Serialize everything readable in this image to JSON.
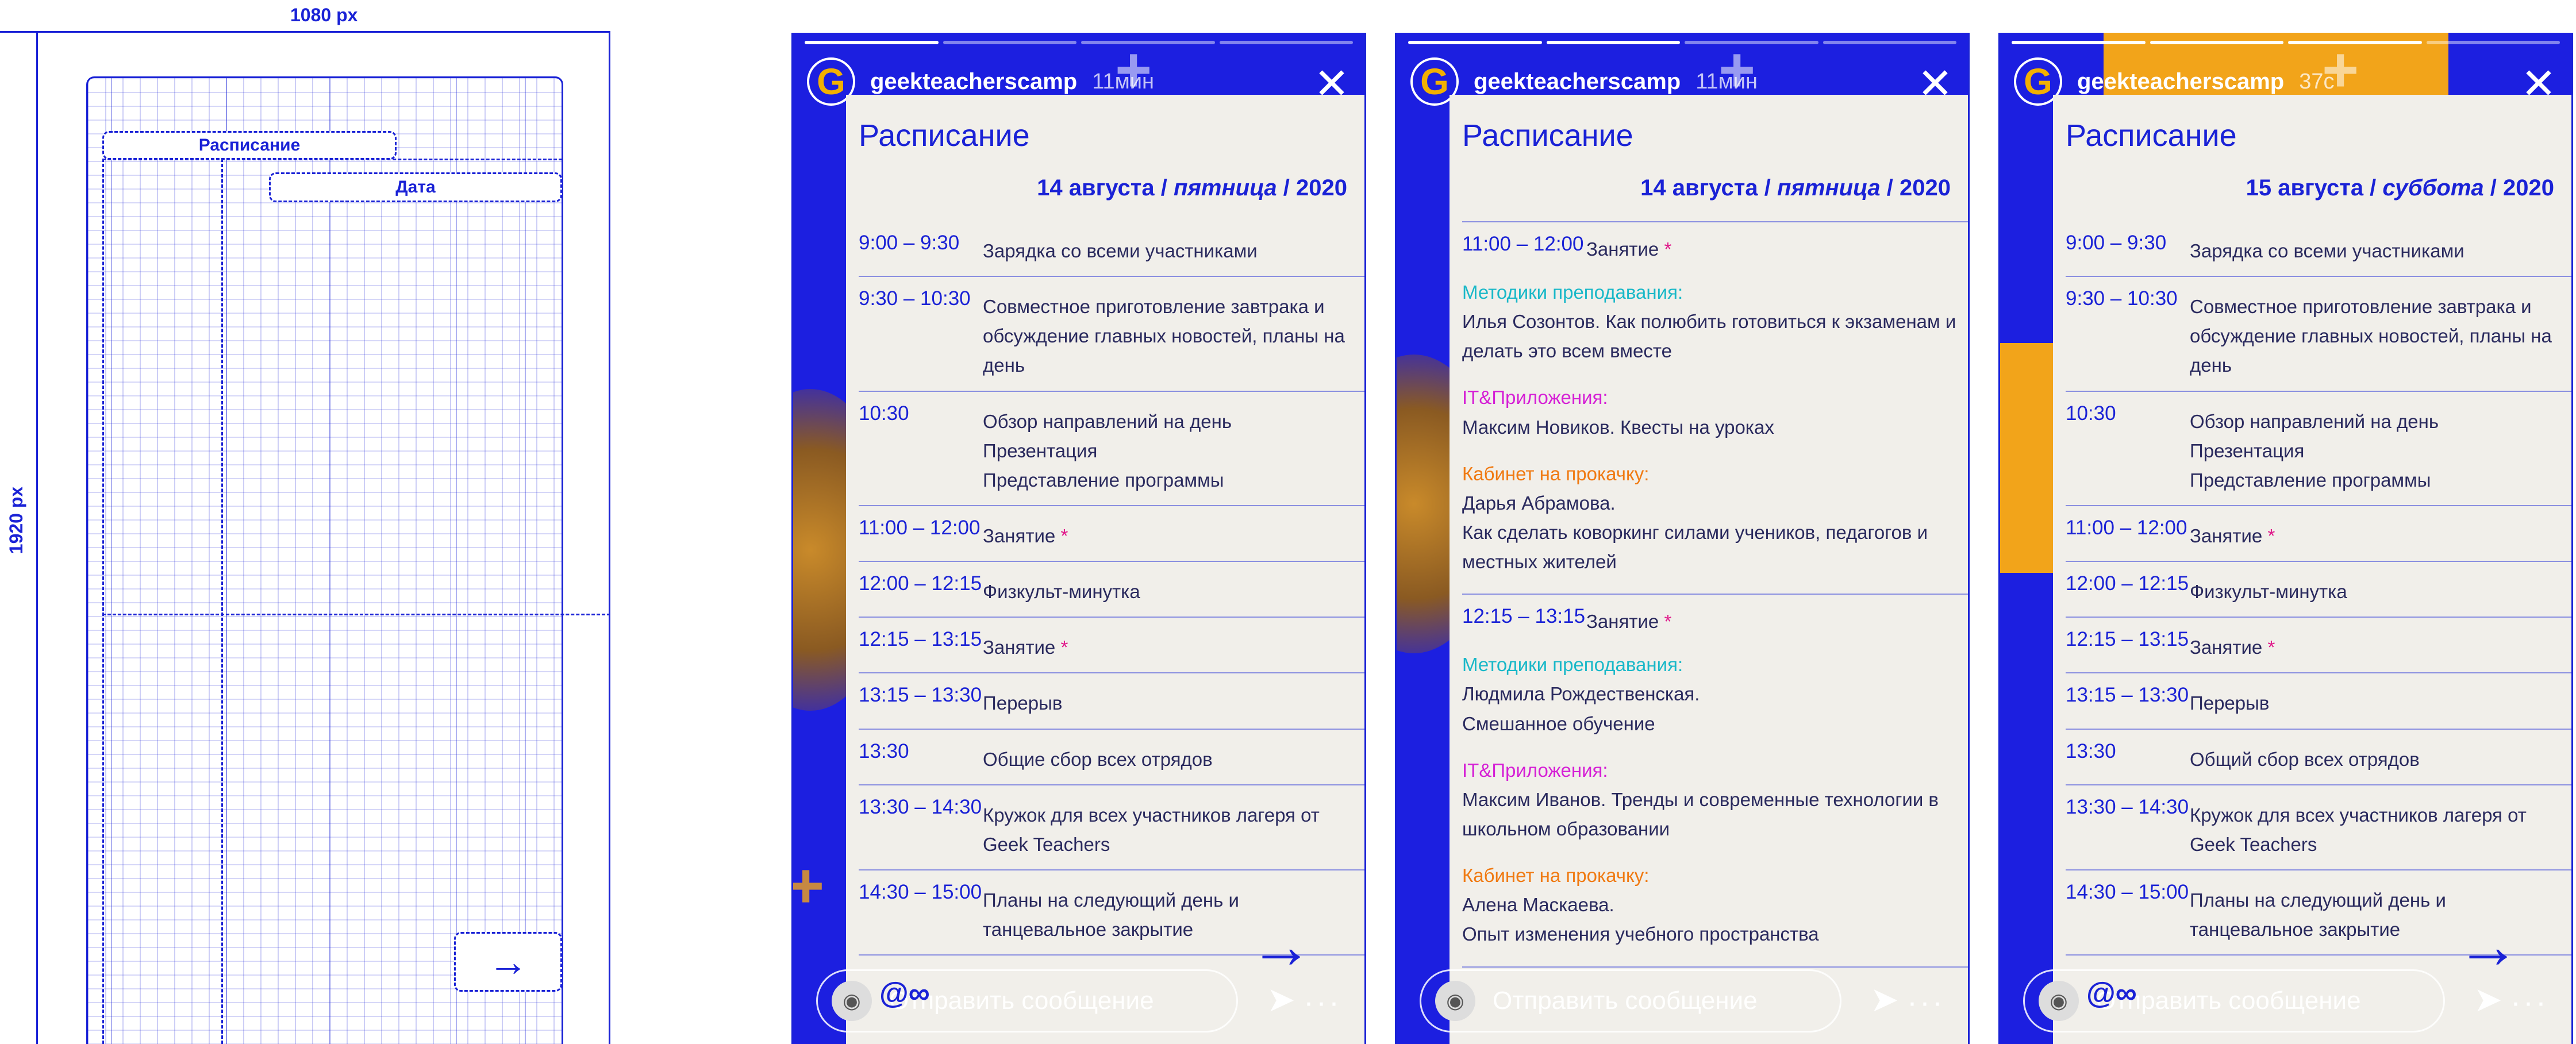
{
  "mockup": {
    "width_label": "1080 px",
    "height_label": "1920 px",
    "schedule_label": "Расписание",
    "date_label": "Дата",
    "arrow_icon": "arrow-right-icon"
  },
  "stories": [
    {
      "username": "geekteacherscamp",
      "time": "11мин",
      "progress_filled": 1,
      "progress_total": 4,
      "title": "Расписание",
      "date": {
        "day": "14 августа /",
        "weekday": "пятница",
        "year": "/ 2020"
      },
      "rows": [
        {
          "time": "9:00 – 9:30",
          "desc": "Зарядка со всеми участниками"
        },
        {
          "time": "9:30 – 10:30",
          "desc": "Совместное приготовление завтрака и обсуждение главных новостей, планы на день"
        },
        {
          "time": "10:30",
          "desc": "Обзор направлений на день\nПрезентация\nПредставление программы"
        },
        {
          "time": "11:00 – 12:00",
          "desc": "Занятие",
          "star": "*"
        },
        {
          "time": "12:00 – 12:15",
          "desc": "Физкульт-минутка"
        },
        {
          "time": "12:15 – 13:15",
          "desc": "Занятие",
          "star": "*"
        },
        {
          "time": "13:15 – 13:30",
          "desc": "Перерыв"
        },
        {
          "time": "13:30",
          "desc": "Общие сбор всех отрядов"
        },
        {
          "time": "13:30 – 14:30",
          "desc": "Кружок для всех участников лагеря от Geek Teachers"
        },
        {
          "time": "14:30 – 15:00",
          "desc": "Планы на следующий день и танцевальное закрытие"
        }
      ],
      "message_placeholder": "Отправить сообщение"
    },
    {
      "username": "geekteacherscamp",
      "time": "11мин",
      "progress_filled": 2,
      "progress_total": 4,
      "title": "Расписание",
      "date": {
        "day": "14 августа /",
        "weekday": "пятница",
        "year": "/ 2020"
      },
      "blocks": [
        {
          "time": "11:00 – 12:00",
          "desc": "Занятие",
          "star": "*",
          "items": [
            {
              "label": "Методики преподавания:",
              "color": "#19b8c8",
              "text": "Илья Созонтов. Как полюбить готовиться к экзаменам и делать это всем вместе"
            },
            {
              "label": "IT&Приложения:",
              "color": "#d51fd5",
              "text": "Максим Новиков. Квесты на уроках"
            },
            {
              "label": "Кабинет на прокачку:",
              "color": "#f07a12",
              "text": "Дарья Абрамова.\nКак сделать коворкинг силами учеников, педагогов и местных жителей"
            }
          ]
        },
        {
          "time": "12:15 – 13:15",
          "desc": "Занятие",
          "star": "*",
          "items": [
            {
              "label": "Методики преподавания:",
              "color": "#19b8c8",
              "text": "Людмила Рождественская.\nСмешанное обучение"
            },
            {
              "label": "IT&Приложения:",
              "color": "#d51fd5",
              "text": "Максим Иванов. Тренды и современные технологии в школьном образовании"
            },
            {
              "label": "Кабинет на прокачку:",
              "color": "#f07a12",
              "text": "Алена Маскаева.\nОпыт изменения учебного пространства"
            }
          ]
        }
      ],
      "message_placeholder": "Отправить сообщение"
    },
    {
      "username": "geekteacherscamp",
      "time": "37с",
      "progress_filled": 3,
      "progress_total": 4,
      "title": "Расписание",
      "date": {
        "day": "15 августа /",
        "weekday": "суббота",
        "year": "/ 2020"
      },
      "rows": [
        {
          "time": "9:00 – 9:30",
          "desc": "Зарядка со всеми участниками"
        },
        {
          "time": "9:30 – 10:30",
          "desc": "Совместное приготовление завтрака и обсуждение главных новостей, планы на день"
        },
        {
          "time": "10:30",
          "desc": "Обзор направлений на день\nПрезентация\nПредставление программы"
        },
        {
          "time": "11:00 – 12:00",
          "desc": "Занятие",
          "star": "*"
        },
        {
          "time": "12:00 – 12:15",
          "desc": "Физкульт-минутка"
        },
        {
          "time": "12:15 – 13:15",
          "desc": "Занятие",
          "star": "*"
        },
        {
          "time": "13:15 – 13:30",
          "desc": "Перерыв"
        },
        {
          "time": "13:30",
          "desc": "Общий сбор всех отрядов"
        },
        {
          "time": "13:30 – 14:30",
          "desc": "Кружок для всех участников лагеря от Geek Teachers"
        },
        {
          "time": "14:30 – 15:00",
          "desc": "Планы на следующий день и танцевальное закрытие"
        }
      ],
      "message_placeholder": "Отправить сообщение"
    }
  ],
  "colors": {
    "accent": "#1a22d6",
    "star": "#e0188a",
    "yellow": "#f2a41a"
  }
}
